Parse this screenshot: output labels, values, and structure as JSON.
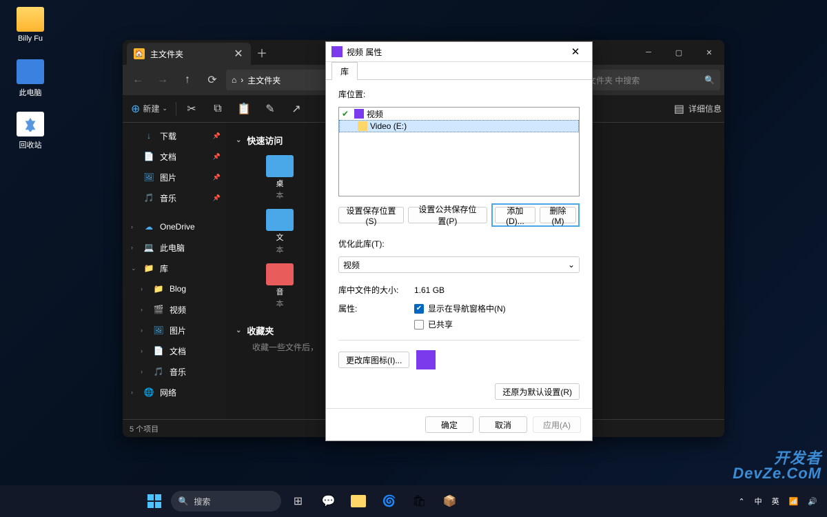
{
  "desktop": {
    "icons": [
      {
        "label": "Billy Fu",
        "color": "#ffd768"
      },
      {
        "label": "此电脑",
        "color": "#3b82e0"
      },
      {
        "label": "回收站",
        "color": "#ffffff"
      }
    ]
  },
  "explorer": {
    "tab_title": "主文件夹",
    "breadcrumb": {
      "home": "⌂",
      "sep": "›",
      "path": "主文件夹"
    },
    "search_placeholder": "文件夹 中搜索",
    "new_label": "新建",
    "view_detail": "详细信息",
    "sidebar": {
      "quick": [
        {
          "label": "下载",
          "icon": "↓",
          "color": "#4aa8e8"
        },
        {
          "label": "文档",
          "icon": "📄",
          "color": "#cfcfcf"
        },
        {
          "label": "图片",
          "icon": "🖼",
          "color": "#4aa8e8"
        },
        {
          "label": "音乐",
          "icon": "🎵",
          "color": "#e85c5c"
        }
      ],
      "nav": [
        {
          "label": "OneDrive",
          "icon": "☁",
          "chev": "›"
        },
        {
          "label": "此电脑",
          "icon": "💻",
          "chev": "›"
        },
        {
          "label": "库",
          "icon": "📁",
          "chev": "⌄",
          "expanded": true
        },
        {
          "label": "Blog",
          "icon": "📁",
          "indent": true,
          "chev": "›"
        },
        {
          "label": "视频",
          "icon": "🎬",
          "indent": true,
          "chev": "›"
        },
        {
          "label": "图片",
          "icon": "🖼",
          "indent": true,
          "chev": "›"
        },
        {
          "label": "文档",
          "icon": "📄",
          "indent": true,
          "chev": "›"
        },
        {
          "label": "音乐",
          "icon": "🎵",
          "indent": true,
          "chev": "›"
        },
        {
          "label": "网络",
          "icon": "🌐",
          "chev": "›"
        }
      ]
    },
    "content": {
      "quick_access": "快速访问",
      "items": [
        {
          "name": "桌",
          "sub": "本",
          "color": "#4aa8e8"
        },
        {
          "name": "文",
          "sub": "本",
          "color": "#4aa8e8"
        },
        {
          "name": "音",
          "sub": "本",
          "color": "#e85c5c"
        }
      ],
      "favorites": "收藏夹",
      "fav_hint": "收藏一些文件后，"
    },
    "status": "5 个项目"
  },
  "dialog": {
    "title": "视频 属性",
    "tab": "库",
    "location_label": "库位置:",
    "lib_items": [
      {
        "label": "视频",
        "indent": 0,
        "selected": false
      },
      {
        "label": "Video (E:)",
        "indent": 1,
        "selected": true
      }
    ],
    "btn_save_loc": "设置保存位置(S)",
    "btn_public_loc": "设置公共保存位置(P)",
    "btn_add": "添加(D)...",
    "btn_remove": "删除(M)",
    "optimize_label": "优化此库(T):",
    "optimize_value": "视频",
    "size_label": "库中文件的大小:",
    "size_value": "1.61 GB",
    "attr_label": "属性:",
    "attr_nav": "显示在导航窗格中(N)",
    "attr_shared": "已共享",
    "btn_change_icon": "更改库图标(I)...",
    "btn_restore": "还原为默认设置(R)",
    "btn_ok": "确定",
    "btn_cancel": "取消",
    "btn_apply": "应用(A)"
  },
  "taskbar": {
    "search": "搜索",
    "tray": {
      "ime1": "中",
      "ime2": "英",
      "net": "📶"
    }
  },
  "watermark": {
    "line1": "开发者",
    "line2": "DevZe.CoM"
  }
}
